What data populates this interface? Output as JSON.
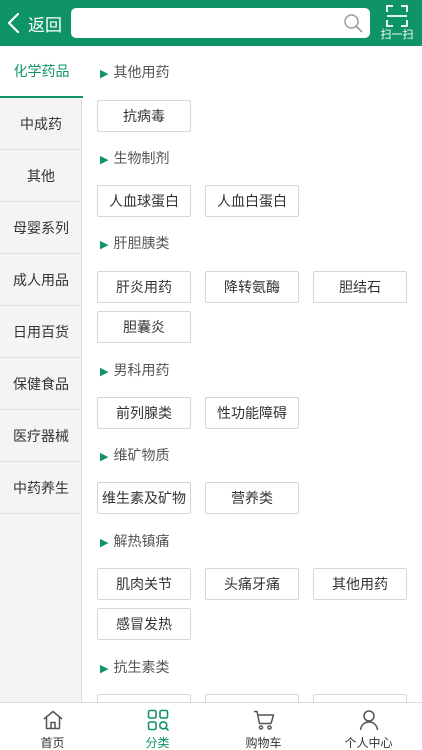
{
  "colors": {
    "accent": "#0f9467",
    "sidebar_bg": "#f4f4f4",
    "chip_border": "#d6d6d6"
  },
  "header": {
    "back_label": "返回",
    "search_placeholder": "",
    "scan_label": "扫一扫",
    "icons": [
      "chevron-left-icon",
      "search-icon",
      "scan-icon"
    ]
  },
  "sidebar": {
    "items": [
      {
        "label": "化学药品",
        "active": true
      },
      {
        "label": "中成药"
      },
      {
        "label": "其他"
      },
      {
        "label": "母婴系列"
      },
      {
        "label": "成人用品"
      },
      {
        "label": "日用百货"
      },
      {
        "label": "保健食品"
      },
      {
        "label": "医疗器械"
      },
      {
        "label": "中药养生"
      }
    ]
  },
  "sections": [
    {
      "title": "其他用药",
      "items": [
        "抗病毒"
      ]
    },
    {
      "title": "生物制剂",
      "items": [
        "人血球蛋白",
        "人血白蛋白"
      ]
    },
    {
      "title": "肝胆胰类",
      "items": [
        "肝炎用药",
        "降转氨酶",
        "胆结石",
        "胆囊炎"
      ]
    },
    {
      "title": "男科用药",
      "items": [
        "前列腺类",
        "性功能障碍"
      ]
    },
    {
      "title": "维矿物质",
      "items": [
        "维生素及矿物",
        "营养类"
      ]
    },
    {
      "title": "解热镇痛",
      "items": [
        "肌肉关节",
        "头痛牙痛",
        "其他用药",
        "感冒发热"
      ]
    },
    {
      "title": "抗生素类",
      "items": [
        "",
        "",
        ""
      ]
    }
  ],
  "tabbar": {
    "tabs": [
      {
        "label": "首页",
        "icon": "home-icon"
      },
      {
        "label": "分类",
        "icon": "category-icon",
        "active": true
      },
      {
        "label": "购物车",
        "icon": "cart-icon"
      },
      {
        "label": "个人中心",
        "icon": "user-icon"
      }
    ]
  }
}
